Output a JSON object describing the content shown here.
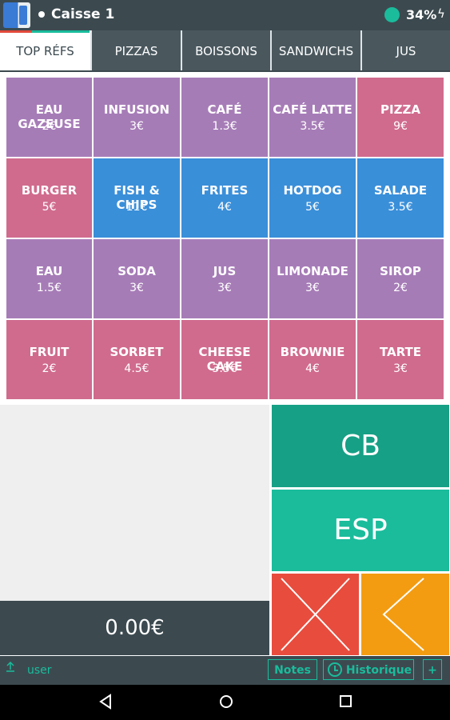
{
  "status_bar": {
    "title": "Caisse 1",
    "battery": "34%",
    "bolt": "ϟ"
  },
  "tabs": [
    {
      "label": "TOP RÉFS",
      "active": true
    },
    {
      "label": "PIZZAS"
    },
    {
      "label": "BOISSONS"
    },
    {
      "label": "SANDWICHS"
    },
    {
      "label": "JUS"
    }
  ],
  "colors": {
    "purple": "#a67cb7",
    "pink": "#d06b8e",
    "blue": "#3a8fd9",
    "dark": "#3c4a50",
    "green_dark": "#16a085",
    "green": "#1abc9c",
    "red": "#e84c3d",
    "orange": "#f39c12"
  },
  "products": [
    {
      "name": "EAU GAZEUSE",
      "price": "2€",
      "color": "purple"
    },
    {
      "name": "INFUSION",
      "price": "3€",
      "color": "purple"
    },
    {
      "name": "CAFÉ",
      "price": "1.3€",
      "color": "purple"
    },
    {
      "name": "CAFÉ LATTE",
      "price": "3.5€",
      "color": "purple"
    },
    {
      "name": "PIZZA",
      "price": "9€",
      "color": "pink"
    },
    {
      "name": "BURGER",
      "price": "5€",
      "color": "pink"
    },
    {
      "name": "FISH & CHIPS",
      "price": "11€",
      "color": "blue"
    },
    {
      "name": "FRITES",
      "price": "4€",
      "color": "blue"
    },
    {
      "name": "HOTDOG",
      "price": "5€",
      "color": "blue"
    },
    {
      "name": "SALADE",
      "price": "3.5€",
      "color": "blue"
    },
    {
      "name": "EAU",
      "price": "1.5€",
      "color": "purple"
    },
    {
      "name": "SODA",
      "price": "3€",
      "color": "purple"
    },
    {
      "name": "JUS",
      "price": "3€",
      "color": "purple"
    },
    {
      "name": "LIMONADE",
      "price": "3€",
      "color": "purple"
    },
    {
      "name": "SIROP",
      "price": "2€",
      "color": "purple"
    },
    {
      "name": "FRUIT",
      "price": "2€",
      "color": "pink"
    },
    {
      "name": "SORBET",
      "price": "4.5€",
      "color": "pink"
    },
    {
      "name": "CHEESE CAKE",
      "price": "3.5€",
      "color": "pink"
    },
    {
      "name": "BROWNIE",
      "price": "4€",
      "color": "pink"
    },
    {
      "name": "TARTE",
      "price": "3€",
      "color": "pink"
    }
  ],
  "total": "0.00€",
  "payment": {
    "cb_label": "CB",
    "esp_label": "ESP",
    "cancel_icon": "close-x-icon",
    "back_icon": "chevron-left-icon"
  },
  "user_bar": {
    "user": "user",
    "notes": "Notes",
    "history": "Historique",
    "plus": "+"
  }
}
